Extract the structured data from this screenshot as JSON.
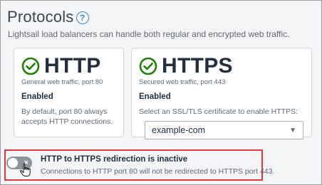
{
  "header": {
    "title": "Protocols",
    "help_glyph": "?",
    "subtitle": "Lightsail load balancers can handle both regular and encrypted web traffic."
  },
  "cards": {
    "http": {
      "title": "HTTP",
      "subtitle": "General web traffic, port 80",
      "status": "Enabled",
      "description": "By default, port 80 always accepts HTTP connections.",
      "icon": "check-circle-icon"
    },
    "https": {
      "title": "HTTPS",
      "subtitle": "Secured web traffic, port 443",
      "status": "Enabled",
      "description": "Select an SSL/TLS certificate to enable HTTPS:",
      "certificate_select": {
        "value": "example-com"
      },
      "icon": "check-circle-icon"
    }
  },
  "redirection": {
    "title": "HTTP to HTTPS redirection is inactive",
    "description": "Connections to HTTP port 80 will not be redirected to HTTPS port 443.",
    "toggle_state": "off",
    "toggle_glyph": "×"
  },
  "colors": {
    "check_green": "#1d8102",
    "highlight_red": "#e4363d",
    "toggle_off": "#8d949b",
    "help_blue": "#3a88c4"
  }
}
